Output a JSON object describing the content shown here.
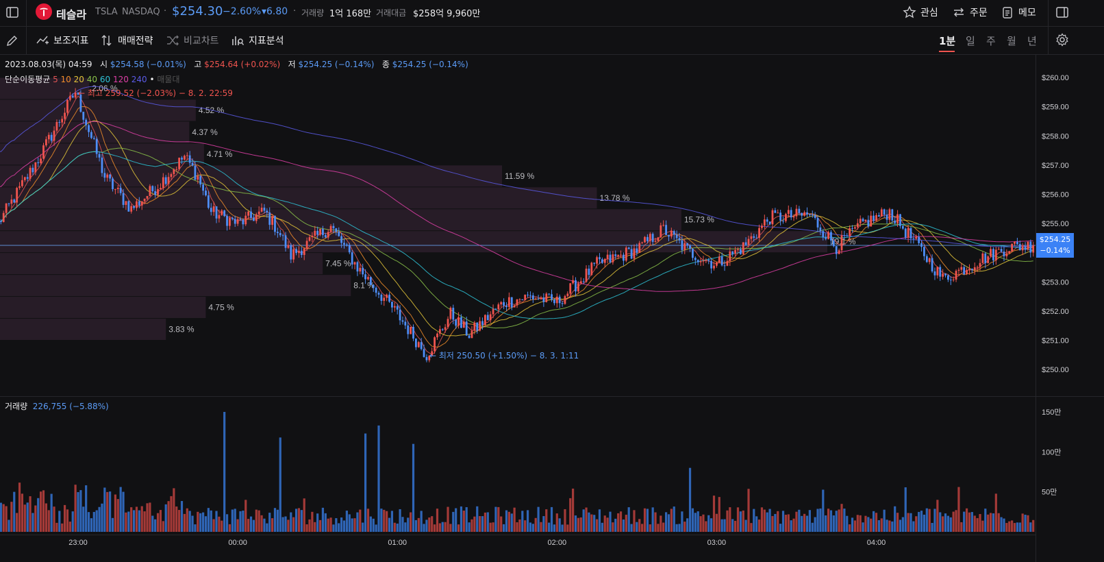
{
  "header": {
    "name": "테슬라",
    "ticker": "TSLA",
    "market": "NASDAQ",
    "separator": "·",
    "price": "$254.30",
    "change_pct": "−2.60%",
    "change_amt": "▾6.80",
    "volume_label": "거래량",
    "volume_value": "1억 168만",
    "amount_label": "거래대금",
    "amount_value": "$258억 9,960만",
    "watch_label": "관심",
    "order_label": "주문",
    "memo_label": "메모"
  },
  "toolbar": {
    "indicators": "보조지표",
    "strategy": "매매전략",
    "compare": "비교차트",
    "analysis": "지표분석",
    "timeframes": [
      "1분",
      "일",
      "주",
      "월",
      "년"
    ],
    "active_timeframe": "1분"
  },
  "info": {
    "date": "2023.08.03(목) 04:59",
    "open_label": "시",
    "open_value": "$254.58 (−0.01%)",
    "high_label": "고",
    "high_value": "$254.64 (+0.02%)",
    "low_label": "저",
    "low_value": "$254.25 (−0.14%)",
    "close_label": "종",
    "close_value": "$254.25 (−0.14%)",
    "ma_label": "단순이동평균",
    "ma_periods": [
      "5",
      "10",
      "20",
      "40",
      "60",
      "120",
      "240"
    ],
    "ma_dot": "•",
    "ma_hidden": "매물대"
  },
  "annotations": {
    "high": "← 최고 259.52 (−2.03%) − 8. 2. 22:59",
    "low": "← 최저 250.50 (+1.50%) − 8. 3. 1:11"
  },
  "current_price": {
    "value": "$254.25",
    "change": "−0.14%"
  },
  "volume_info": {
    "label": "거래량",
    "value": "226,755 (−5.88%)"
  },
  "volume_axis": [
    "150만",
    "100만",
    "50만"
  ],
  "time_axis": [
    "23:00",
    "00:00",
    "01:00",
    "02:00",
    "03:00",
    "04:00"
  ],
  "price_axis": [
    "$260.00",
    "$259.00",
    "$258.00",
    "$257.00",
    "$256.00",
    "$255.00",
    "$253.00",
    "$252.00",
    "$251.00",
    "$250.00"
  ],
  "colors": {
    "up": "#f0544f",
    "down": "#4e8ef7",
    "profile": "#2c1f2b",
    "ma5": "#e05555",
    "ma10": "#f08c2a",
    "ma20": "#e3c53a",
    "ma40": "#8bc34a",
    "ma60": "#2ec4d8",
    "ma120": "#e03fa8",
    "ma240": "#5b5be8"
  },
  "chart_data": {
    "type": "candlestick",
    "interval": "1분",
    "price_axis_range": [
      249.75,
      260.25
    ],
    "x_ticks": [
      "23:00",
      "00:00",
      "01:00",
      "02:00",
      "03:00",
      "04:00"
    ],
    "price_path": [
      {
        "t": "22:30",
        "p": 255.0
      },
      {
        "t": "22:45",
        "p": 257.2
      },
      {
        "t": "22:59",
        "p": 259.52
      },
      {
        "t": "23:10",
        "p": 256.6
      },
      {
        "t": "23:20",
        "p": 255.5
      },
      {
        "t": "23:30",
        "p": 256.3
      },
      {
        "t": "23:40",
        "p": 257.3
      },
      {
        "t": "23:45",
        "p": 256.6
      },
      {
        "t": "23:50",
        "p": 255.4
      },
      {
        "t": "00:00",
        "p": 255.0
      },
      {
        "t": "00:10",
        "p": 255.4
      },
      {
        "t": "00:15",
        "p": 254.8
      },
      {
        "t": "00:20",
        "p": 253.9
      },
      {
        "t": "00:35",
        "p": 254.9
      },
      {
        "t": "00:45",
        "p": 253.5
      },
      {
        "t": "01:00",
        "p": 251.9
      },
      {
        "t": "01:11",
        "p": 250.5
      },
      {
        "t": "01:20",
        "p": 251.9
      },
      {
        "t": "01:27",
        "p": 251.2
      },
      {
        "t": "01:40",
        "p": 252.3
      },
      {
        "t": "01:50",
        "p": 252.5
      },
      {
        "t": "02:00",
        "p": 252.3
      },
      {
        "t": "02:15",
        "p": 253.6
      },
      {
        "t": "02:30",
        "p": 254.1
      },
      {
        "t": "02:40",
        "p": 254.8
      },
      {
        "t": "02:50",
        "p": 254.0
      },
      {
        "t": "03:00",
        "p": 253.6
      },
      {
        "t": "03:10",
        "p": 254.2
      },
      {
        "t": "03:20",
        "p": 255.2
      },
      {
        "t": "03:35",
        "p": 255.3
      },
      {
        "t": "03:45",
        "p": 254.2
      },
      {
        "t": "03:55",
        "p": 255.0
      },
      {
        "t": "04:05",
        "p": 255.4
      },
      {
        "t": "04:15",
        "p": 254.3
      },
      {
        "t": "04:25",
        "p": 253.1
      },
      {
        "t": "04:40",
        "p": 253.8
      },
      {
        "t": "04:50",
        "p": 254.2
      },
      {
        "t": "04:59",
        "p": 254.25
      }
    ],
    "volume_profile": [
      {
        "price_from": 259.25,
        "price_to": 260.0,
        "pct": 2.06
      },
      {
        "price_from": 258.5,
        "price_to": 259.25,
        "pct": 4.52
      },
      {
        "price_from": 257.75,
        "price_to": 258.5,
        "pct": 4.37
      },
      {
        "price_from": 257.0,
        "price_to": 257.75,
        "pct": 4.71
      },
      {
        "price_from": 256.25,
        "price_to": 257.0,
        "pct": 11.59
      },
      {
        "price_from": 255.5,
        "price_to": 256.25,
        "pct": 13.78
      },
      {
        "price_from": 254.75,
        "price_to": 255.5,
        "pct": 15.73
      },
      {
        "price_from": 254.0,
        "price_to": 254.75,
        "pct": 19.1
      },
      {
        "price_from": 253.25,
        "price_to": 254.0,
        "pct": 7.45
      },
      {
        "price_from": 252.5,
        "price_to": 253.25,
        "pct": 8.1
      },
      {
        "price_from": 251.75,
        "price_to": 252.5,
        "pct": 4.75
      },
      {
        "price_from": 251.0,
        "price_to": 251.75,
        "pct": 3.83
      }
    ],
    "volume_spikes": [
      {
        "t": "23:55",
        "v": 1500000
      },
      {
        "t": "00:16",
        "v": 1180000
      },
      {
        "t": "00:48",
        "v": 1230000
      },
      {
        "t": "00:53",
        "v": 1330000
      },
      {
        "t": "01:06",
        "v": 1100000
      },
      {
        "t": "02:50",
        "v": 800000
      }
    ],
    "volume_axis_range": [
      0,
      1500000
    ]
  }
}
